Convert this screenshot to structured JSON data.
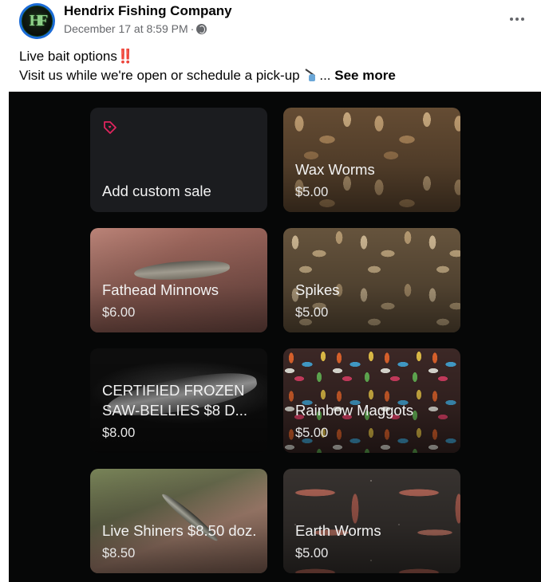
{
  "post": {
    "page_name": "Hendrix Fishing Company",
    "timestamp": "December 17 at 8:59 PM",
    "separator": "·",
    "avatar_letters": "HF",
    "caption_line1": "Live bait options",
    "caption_line1_emoji": "‼️",
    "caption_line2": "Visit us while we're open or schedule a pick-up",
    "caption_ellipsis": "...",
    "see_more": "See more"
  },
  "icons": {
    "privacy": "globe-icon",
    "menu": "more-options-icon",
    "custom_sale": "tag-heart-icon",
    "caption_emoji": "person-fishing-emoji"
  },
  "products": {
    "custom_sale": {
      "label": "Add custom sale"
    },
    "items": [
      {
        "name": "Wax Worms",
        "price": "$5.00"
      },
      {
        "name": "Fathead Minnows",
        "price": "$6.00"
      },
      {
        "name": "Spikes",
        "price": "$5.00"
      },
      {
        "name": "CERTIFIED FROZEN SAW-BELLIES $8 D...",
        "price": "$8.00"
      },
      {
        "name": "Rainbow Maggots",
        "price": "$5.00"
      },
      {
        "name": "Live Shiners $8.50 doz.",
        "price": "$8.50"
      },
      {
        "name": "Earth Worms",
        "price": "$5.00"
      }
    ]
  },
  "colors": {
    "accent_pink": "#e0245e",
    "avatar_ring": "#1b6bd6",
    "image_bg": "#060707",
    "tile_bg": "#1b1c1f"
  }
}
